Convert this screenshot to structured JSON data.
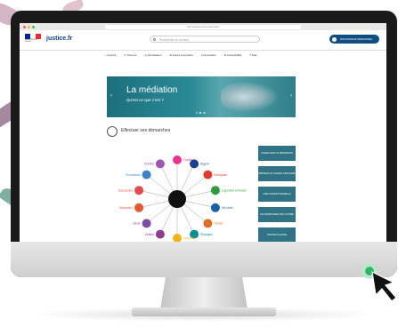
{
  "browser": {
    "url": "http://www.justice.fr/accueil"
  },
  "header": {
    "ministry": "MINISTÈRE DE LA JUSTICE",
    "brand": "justice.fr",
    "search_placeholder": "Rechercher un contenu",
    "account_button": "MON ESPACE PERSONNEL"
  },
  "nav": [
    "⌂ Accueil",
    "⊙ Thèmes",
    "◎ Simulateurs",
    "⊞ Accès à la justice",
    "⊟ Annuaires",
    "⊕ Accessibilité",
    "? Aide"
  ],
  "banner": {
    "title": "La médiation",
    "subtitle": "Qu'est ce que c'est ?",
    "slides": 3,
    "active_slide": 2
  },
  "section": {
    "title": "Effectuer ses démarches"
  },
  "wheel": {
    "labels": [
      "Famille",
      "Argent",
      "Entreprise",
      "Logement et foncier",
      "Vie civile",
      "Travail",
      "Étrangers",
      "Handicap",
      "Victime",
      "Santé",
      "Séparation",
      "Succession",
      "Procédures",
      "Mobilité"
    ],
    "colors": [
      "#e8348f",
      "#1d3f8f",
      "#e23b2e",
      "#2e9c3a",
      "#1c5fa8",
      "#e06d24",
      "#0a8f92",
      "#f0b41c",
      "#8f3a8f",
      "#7a4fa1",
      "#e4572e",
      "#e34a4a",
      "#3d82c4",
      "#9b59b6"
    ]
  },
  "side_buttons": [
    "CONSULTER UN MÉDIATEUR",
    "OBTENIR UN CASIER JUDICIAIRE",
    "AIDE JURIDICTIONNELLE",
    "ACCOMPAGNER UNE VICTIME",
    "PORTER PLAINTE"
  ]
}
